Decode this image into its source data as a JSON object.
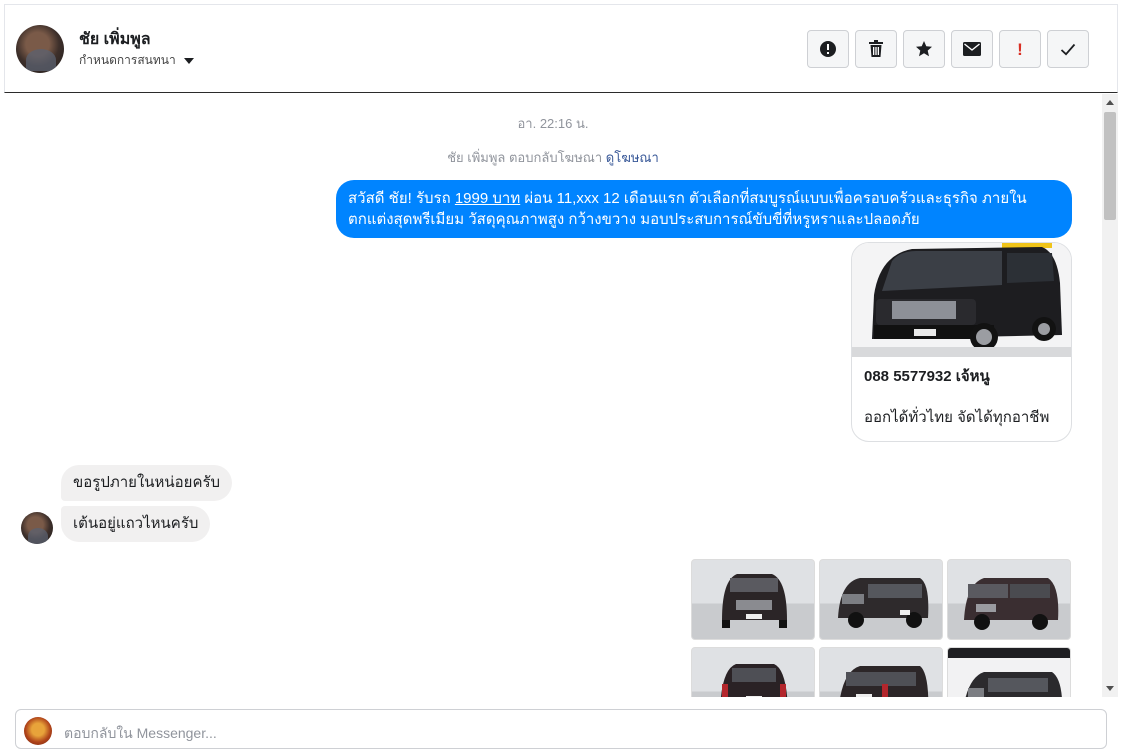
{
  "header": {
    "name": "ชัย เพิ่มพูล",
    "assign_label": "กำหนดการสนทนา",
    "actions": [
      {
        "icon": "info-circle-icon"
      },
      {
        "icon": "trash-icon"
      },
      {
        "icon": "star-icon"
      },
      {
        "icon": "envelope-icon"
      },
      {
        "icon": "exclamation-icon",
        "label": "!",
        "color": "#d93025"
      },
      {
        "icon": "check-icon"
      }
    ]
  },
  "thread": {
    "timestamp": "อา. 22:16 น.",
    "ad_reply": {
      "text": "ชัย เพิ่มพูล ตอบกลับโฆษณา",
      "link": "ดูโฆษณา"
    },
    "outgoing": {
      "text_before": "สวัสดี ชัย! รับรถ ",
      "price": "1999 บาท",
      "text_after": " ผ่อน 11,xxx 12 เดือนแรก ตัวเลือกที่สมบูรณ์แบบเพื่อครอบครัวและธุรกิจ ภายในตกแต่งสุดพรีเมียม วัสดุคุณภาพสูง กว้างขวาง มอบประสบการณ์ขับขี่ที่หรูหราและปลอดภัย",
      "bubble_color": "#0084ff"
    },
    "ad_card": {
      "title": "088 5577932 เจ้หนู",
      "subtitle": "ออกได้ทั่วไทย จัดได้ทุกอาชีพ"
    },
    "incoming": [
      {
        "text": "ขอรูปภายในหน่อยครับ"
      },
      {
        "text": "เต้นอยู่แถวไหนครับ"
      }
    ],
    "photos_count_visible": 6
  },
  "composer": {
    "placeholder": "ตอบกลับใน Messenger..."
  }
}
